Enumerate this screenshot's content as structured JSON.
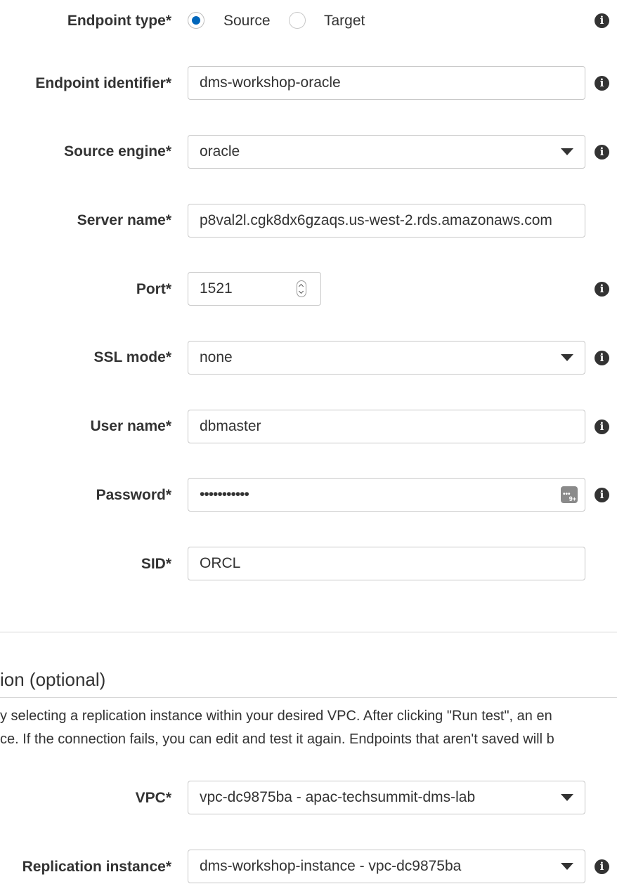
{
  "endpoint_type": {
    "label": "Endpoint type*",
    "options": [
      {
        "label": "Source",
        "selected": true
      },
      {
        "label": "Target",
        "selected": false
      }
    ]
  },
  "endpoint_identifier": {
    "label": "Endpoint identifier*",
    "value": "dms-workshop-oracle"
  },
  "source_engine": {
    "label": "Source engine*",
    "value": "oracle"
  },
  "server_name": {
    "label": "Server name*",
    "value": "p8val2l.cgk8dx6gzaqs.us-west-2.rds.amazonaws.com"
  },
  "port": {
    "label": "Port*",
    "value": "1521"
  },
  "ssl_mode": {
    "label": "SSL mode*",
    "value": "none"
  },
  "user_name": {
    "label": "User name*",
    "value": "dbmaster"
  },
  "password": {
    "label": "Password*",
    "value": "•••••••••••",
    "manager_badge": "9+"
  },
  "sid": {
    "label": "SID*",
    "value": "ORCL"
  },
  "test_section": {
    "title": "ion (optional)",
    "description_line1": "y selecting a replication instance within your desired VPC. After clicking \"Run test\", an en",
    "description_line2": "ce. If the connection fails, you can edit and test it again. Endpoints that aren't saved will b"
  },
  "vpc": {
    "label": "VPC*",
    "value": "vpc-dc9875ba - apac-techsummit-dms-lab"
  },
  "replication_instance": {
    "label": "Replication instance*",
    "value": "dms-workshop-instance - vpc-dc9875ba"
  },
  "info_icon_glyph": "i",
  "colors": {
    "radio_selected": "#0066bb",
    "border": "#c8c8c8",
    "text": "#333333"
  }
}
